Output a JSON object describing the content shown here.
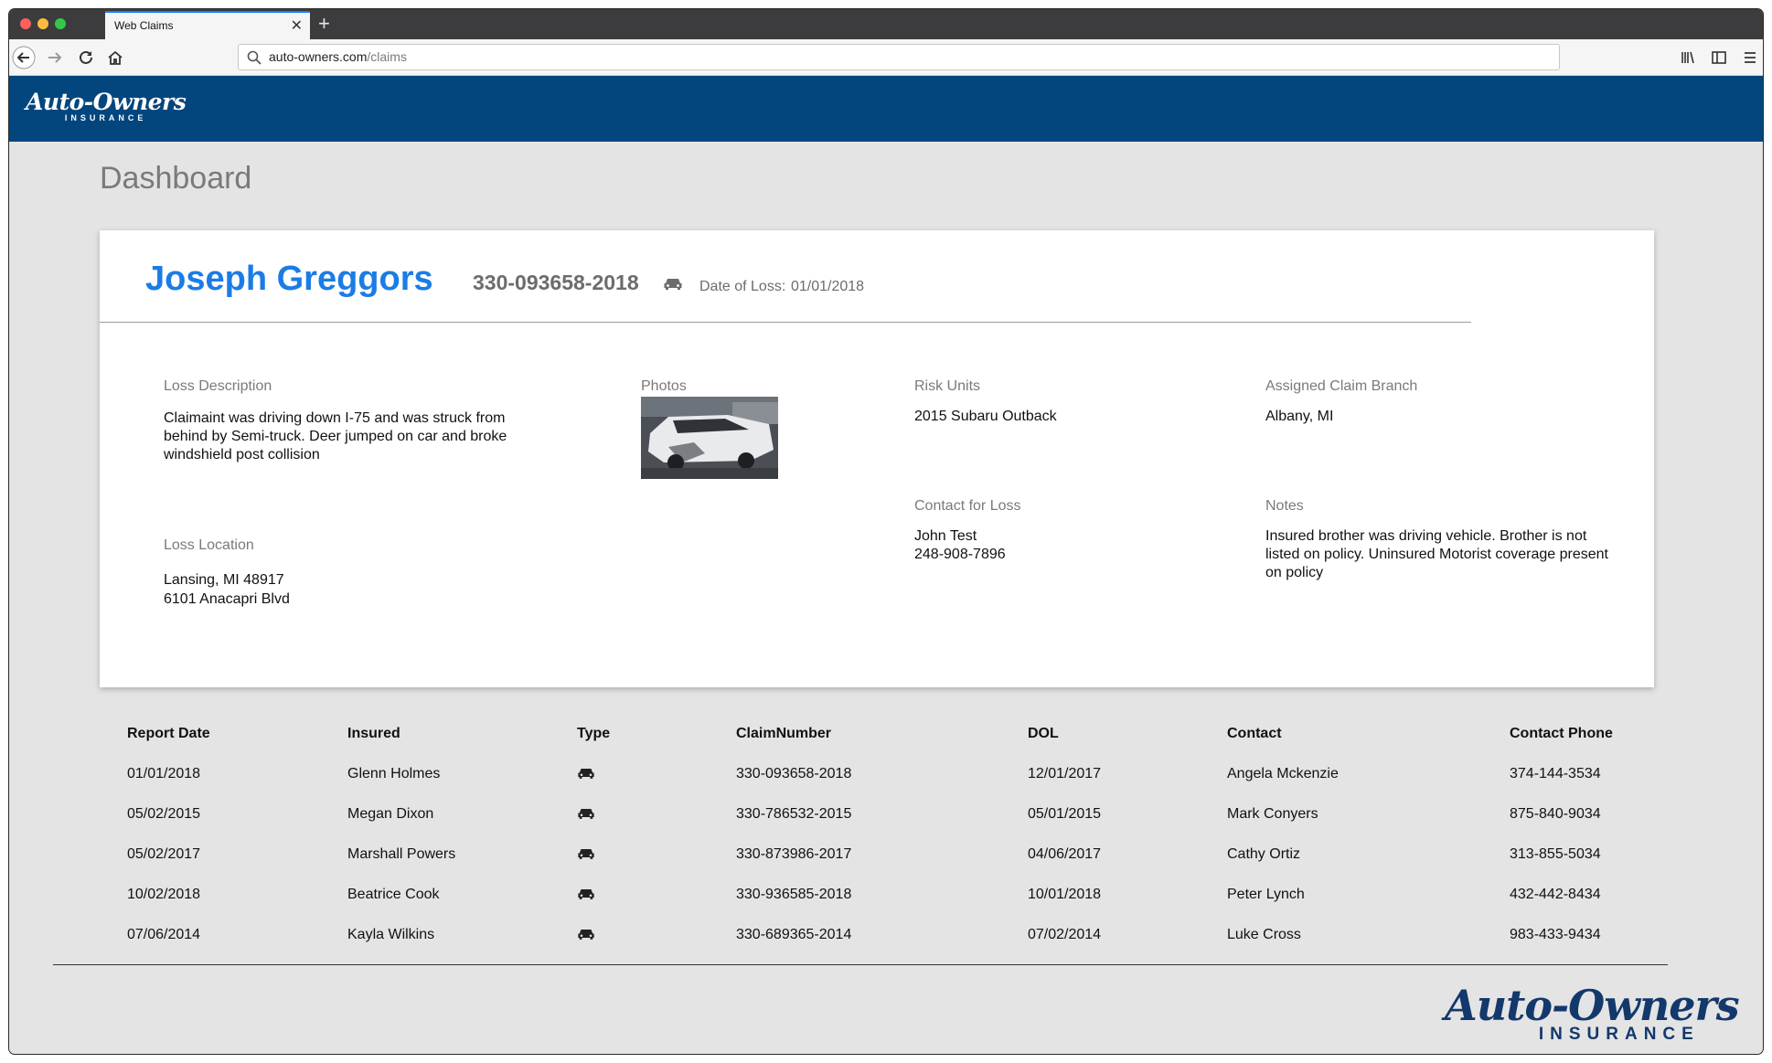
{
  "browser": {
    "tab_title": "Web Claims",
    "tab_close": "✕",
    "new_tab": "+",
    "url_host": "auto-owners.com",
    "url_path": "/claims"
  },
  "brand": {
    "logo_script": "Auto-Owners",
    "logo_sub": "INSURANCE",
    "header_color": "#02467d",
    "accent_color": "#1b7ce6"
  },
  "page": {
    "title": "Dashboard"
  },
  "claim": {
    "claimant_name": "Joseph Greggors",
    "claim_number": "330-093658-2018",
    "type_icon": "car-icon",
    "date_of_loss_label": "Date of Loss:",
    "date_of_loss": "01/01/2018",
    "loss_description_label": "Loss Description",
    "loss_description": "Claimaint was driving down I-75 and was struck from behind by Semi-truck. Deer jumped on car and broke windshield post collision",
    "loss_location_label": "Loss Location",
    "loss_location_line1": "Lansing, MI 48917",
    "loss_location_line2": "6101 Anacapri Blvd",
    "photos_label": "Photos",
    "risk_units_label": "Risk Units",
    "risk_units": "2015 Subaru Outback",
    "contact_label": "Contact for Loss",
    "contact_name": "John Test",
    "contact_phone": "248-908-7896",
    "branch_label": "Assigned Claim Branch",
    "branch": "Albany, MI",
    "notes_label": "Notes",
    "notes": "Insured brother was driving vehicle. Brother is not listed on policy. Uninsured Motorist coverage present on policy"
  },
  "table": {
    "headers": [
      "Report Date",
      "Insured",
      "Type",
      "ClaimNumber",
      "DOL",
      "Contact",
      "Contact Phone"
    ],
    "rows": [
      {
        "report_date": "01/01/2018",
        "insured": "Glenn Holmes",
        "claim_number": "330-093658-2018",
        "dol": "12/01/2017",
        "contact": "Angela Mckenzie",
        "phone": "374-144-3534"
      },
      {
        "report_date": "05/02/2015",
        "insured": "Megan Dixon",
        "claim_number": "330-786532-2015",
        "dol": "05/01/2015",
        "contact": "Mark Conyers",
        "phone": "875-840-9034"
      },
      {
        "report_date": "05/02/2017",
        "insured": "Marshall Powers",
        "claim_number": "330-873986-2017",
        "dol": "04/06/2017",
        "contact": "Cathy Ortiz",
        "phone": "313-855-5034"
      },
      {
        "report_date": "10/02/2018",
        "insured": "Beatrice Cook",
        "claim_number": "330-936585-2018",
        "dol": "10/01/2018",
        "contact": "Peter Lynch",
        "phone": "432-442-8434"
      },
      {
        "report_date": "07/06/2014",
        "insured": "Kayla Wilkins",
        "claim_number": "330-689365-2014",
        "dol": "07/02/2014",
        "contact": "Luke Cross",
        "phone": "983-433-9434"
      }
    ]
  }
}
